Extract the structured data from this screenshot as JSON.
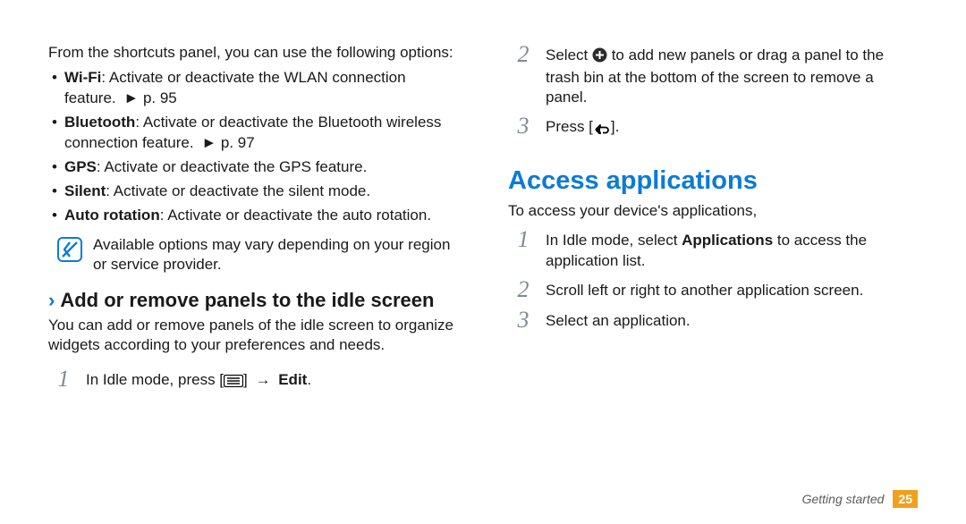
{
  "left": {
    "intro": "From the shortcuts panel, you can use the following options:",
    "bullets": [
      {
        "label": "Wi-Fi",
        "desc": ": Activate or deactivate the WLAN connection feature.",
        "ref": "► p. 95"
      },
      {
        "label": "Bluetooth",
        "desc": ": Activate or deactivate the Bluetooth wireless connection feature.",
        "ref": "► p. 97"
      },
      {
        "label": "GPS",
        "desc": ": Activate or deactivate the GPS feature.",
        "ref": ""
      },
      {
        "label": "Silent",
        "desc": ": Activate or deactivate the silent mode.",
        "ref": ""
      },
      {
        "label": "Auto rotation",
        "desc": ": Activate or deactivate the auto rotation.",
        "ref": ""
      }
    ],
    "note": "Available options may vary depending on your region or service provider.",
    "sub_heading": "Add or remove panels to the idle screen",
    "sub_body": "You can add or remove panels of the idle screen to organize widgets according to your preferences and needs.",
    "step1_prefix": "In Idle mode, press [",
    "step1_arrow": "→",
    "step1_middle": "] ",
    "step1_edit": "Edit",
    "step1_suffix": "."
  },
  "right": {
    "step2_a": "Select ",
    "step2_b": " to add new panels or drag a panel to the trash bin at the bottom of the screen to remove a panel.",
    "step3_a": "Press [",
    "step3_b": "].",
    "heading": "Access applications",
    "intro2": "To access your device's applications,",
    "r1_a": "In Idle mode, select ",
    "r1_app": "Applications",
    "r1_b": " to access the application list.",
    "r2": "Scroll left or right to another application screen.",
    "r3": "Select an application."
  },
  "footer": {
    "section": "Getting started",
    "page": "25"
  }
}
